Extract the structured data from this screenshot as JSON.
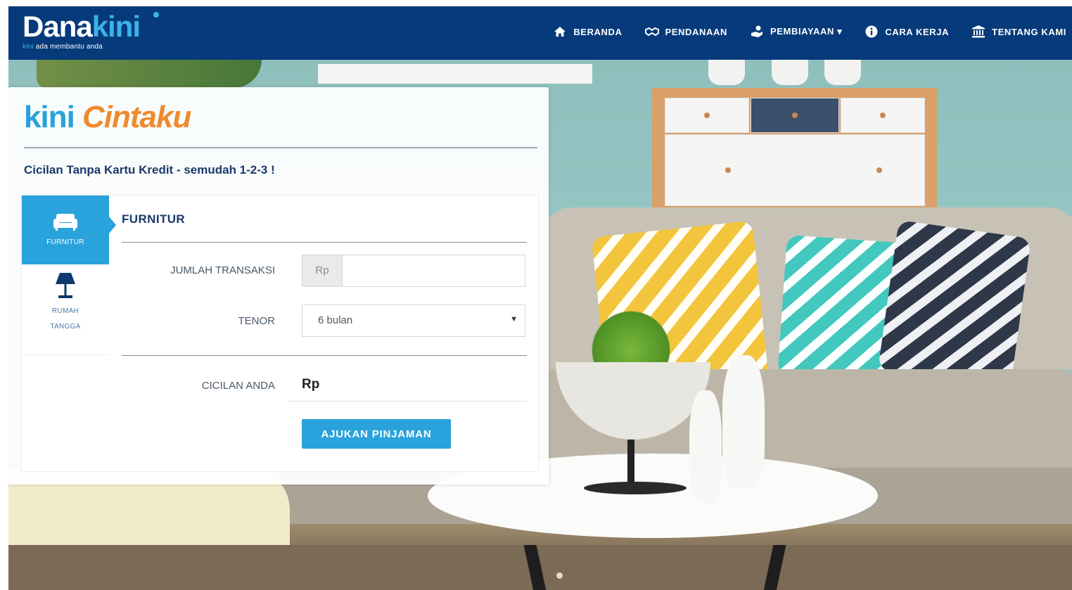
{
  "brand": {
    "name_main": "Dana",
    "name_accent": "kini",
    "tagline_accent": "kini",
    "tagline_rest": " ada membantu anda"
  },
  "nav": [
    {
      "label": "BERANDA",
      "icon": "home-icon"
    },
    {
      "label": "PENDANAAN",
      "icon": "handshake-icon"
    },
    {
      "label": "PEMBIAYAAN ▾",
      "icon": "hand-coin-icon"
    },
    {
      "label": "CARA KERJA",
      "icon": "info-icon"
    },
    {
      "label": "TENTANG KAMI",
      "icon": "bank-icon"
    }
  ],
  "panel": {
    "logo_kini": "kini",
    "logo_cintaku": "Cintaku",
    "tagline": "Cicilan Tanpa Kartu Kredit - semudah 1-2-3 !"
  },
  "tabs": [
    {
      "label": "FURNITUR",
      "icon": "sofa-icon",
      "active": true
    },
    {
      "label_line1": "RUMAH",
      "label_line2": "TANGGA",
      "icon": "lamp-icon",
      "active": false
    }
  ],
  "form": {
    "section_title": "FURNITUR",
    "amount_label": "JUMLAH TRANSAKSI",
    "amount_prefix": "Rp",
    "amount_value": "",
    "tenor_label": "TENOR",
    "tenor_value": "6 bulan",
    "installment_label": "CICILAN ANDA",
    "installment_value": "Rp",
    "submit_label": "AJUKAN PINJAMAN"
  },
  "colors": {
    "navbar": "#063a7a",
    "accent": "#2aa2dc",
    "orange": "#f08a2c",
    "heading": "#1b3a6a"
  }
}
